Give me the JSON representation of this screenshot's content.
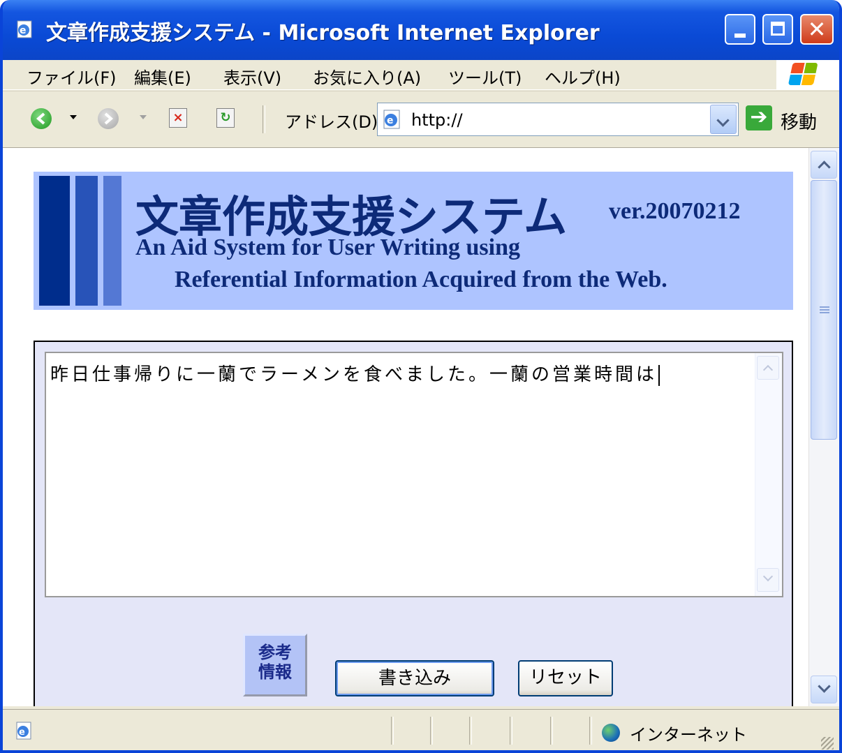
{
  "window": {
    "title": "文章作成支援システム - Microsoft Internet Explorer",
    "close_glyph": "✕"
  },
  "menu": {
    "items": [
      {
        "label": "ファイル(F)"
      },
      {
        "label": "編集(E)"
      },
      {
        "label": "表示(V)"
      },
      {
        "label": "お気に入り(A)"
      },
      {
        "label": "ツール(T)"
      },
      {
        "label": "ヘルプ(H)"
      }
    ]
  },
  "toolbar": {
    "address_label": "アドレス(D)",
    "address_value": "http://",
    "go_label": "移動"
  },
  "banner": {
    "title": "文章作成支援システム",
    "version": "ver.20070212",
    "subtitle_line1": "An Aid System for User Writing using",
    "subtitle_line2": "Referential Information Acquired from the Web."
  },
  "form": {
    "textarea_value": "昨日仕事帰りに一蘭でラーメンを食べました。一蘭の営業時間は",
    "ref_button_line1": "参考",
    "ref_button_line2": "情報",
    "write_button": "書き込み",
    "reset_button": "リセット"
  },
  "status": {
    "zone": "インターネット"
  },
  "colors": {
    "title_bar": "#0a4ad6",
    "banner_bg": "#aec4ff",
    "banner_text": "#0d2a78",
    "form_bg": "#e4e6f8"
  }
}
